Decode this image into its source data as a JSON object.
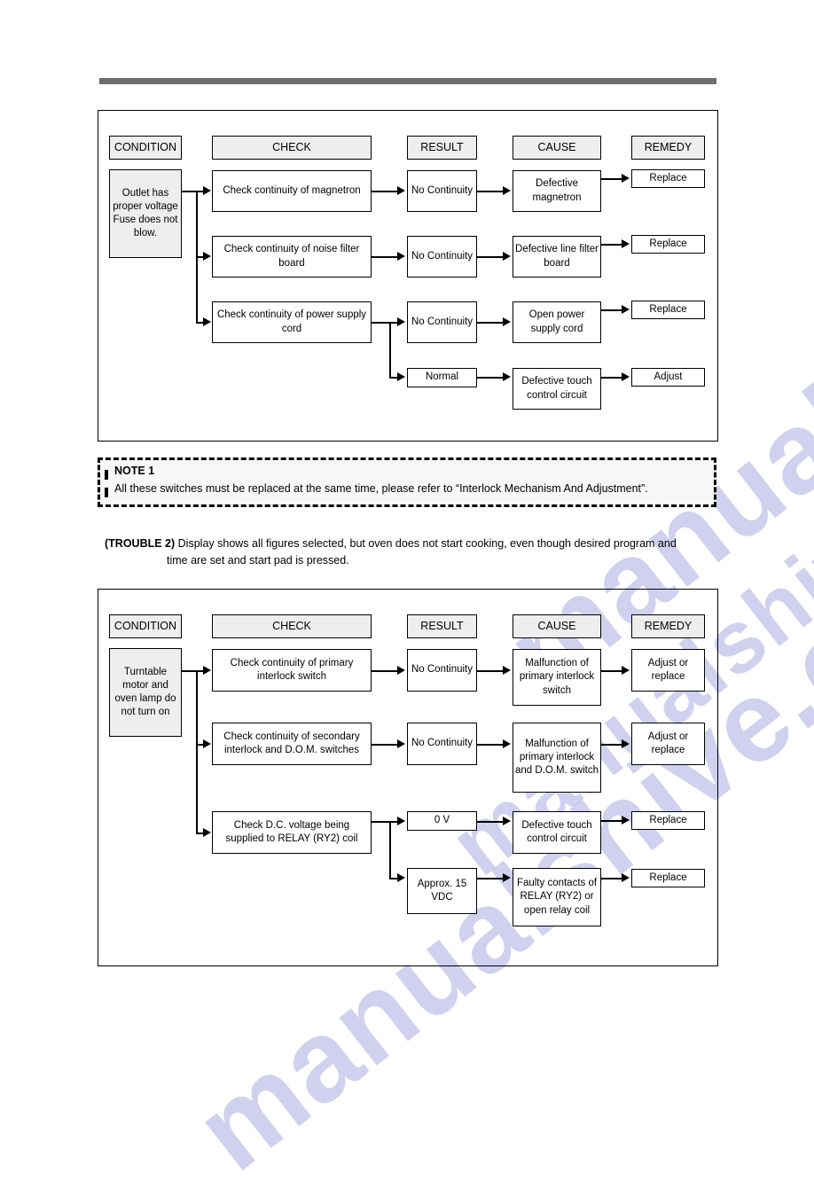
{
  "page": {
    "watermark": "manualshive.com"
  },
  "note": {
    "title": "NOTE 1",
    "body": "All these switches must be replaced at the same time, please refer to “Interlock Mechanism And Adjustment”."
  },
  "trouble": {
    "label": "(TROUBLE 2)",
    "line1": "Display shows all figures selected, but oven does not start cooking, even though desired program and",
    "line2": "time are set and start pad is pressed."
  },
  "headers": {
    "condition": "CONDITION",
    "check": "CHECK",
    "result": "RESULT",
    "cause": "CAUSE",
    "remedy": "REMEDY"
  },
  "chart1": {
    "condition": "Outlet has proper voltage Fuse does not blow.",
    "checks": [
      "Check continuity of magnetron",
      "Check continuity of noise filter board",
      "Check continuity of power supply cord"
    ],
    "results": [
      "No Continuity",
      "No Continuity",
      "No Continuity",
      "Normal"
    ],
    "causes": [
      "Defective magnetron",
      "Defective line filter board",
      "Open power supply cord",
      "Defective touch control circuit"
    ],
    "remedies": [
      "Replace",
      "Replace",
      "Replace",
      "Adjust"
    ]
  },
  "chart2": {
    "condition": "Turntable motor and oven lamp do not turn on",
    "checks": [
      "Check continuity of primary interlock switch",
      "Check continuity of secondary interlock and D.O.M. switches",
      "Check D.C. voltage being supplied to RELAY (RY2) coil"
    ],
    "results": [
      "No Continuity",
      "No Continuity",
      "0 V",
      "Approx. 15 VDC"
    ],
    "causes": [
      "Malfunction of primary interlock switch",
      "Malfunction of primary interlock and D.O.M. switch",
      "Defective touch control circuit",
      "Faulty contacts of RELAY (RY2) or open relay coil"
    ],
    "remedies": [
      "Adjust or replace",
      "Adjust or replace",
      "Replace",
      "Replace"
    ]
  }
}
